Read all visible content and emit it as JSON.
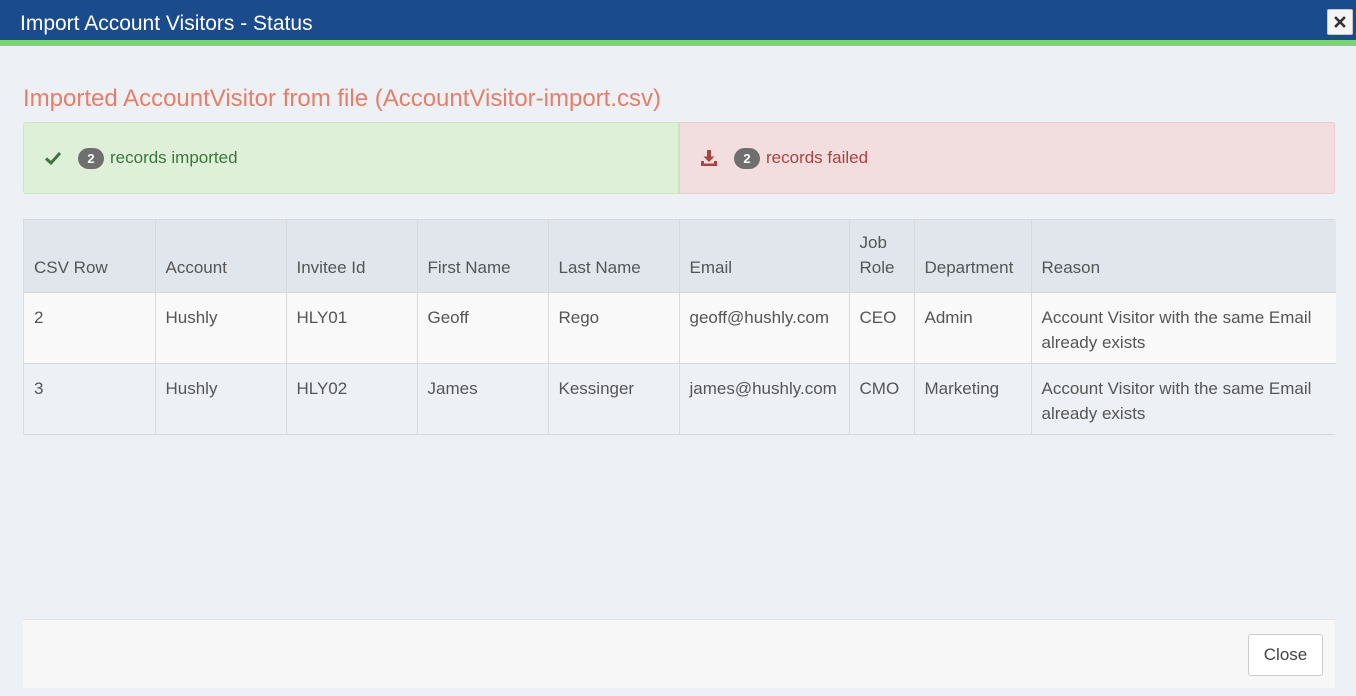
{
  "window": {
    "title": "Import Account Visitors - Status"
  },
  "heading": "Imported AccountVisitor from file (AccountVisitor-import.csv)",
  "alerts": {
    "success": {
      "count": "2",
      "label": "records imported",
      "icon": "check-icon",
      "color": "#3c763d"
    },
    "failed": {
      "count": "2",
      "label": "records failed",
      "icon": "download-icon",
      "color": "#a94442"
    }
  },
  "table": {
    "columns": [
      "CSV Row",
      "Account",
      "Invitee Id",
      "First Name",
      "Last Name",
      "Email",
      "Job Role",
      "Department",
      "Reason"
    ],
    "rows": [
      [
        "2",
        "Hushly",
        "HLY01",
        "Geoff",
        "Rego",
        "geoff@hushly.com",
        "CEO",
        "Admin",
        "Account Visitor with the same Email already exists"
      ],
      [
        "3",
        "Hushly",
        "HLY02",
        "James",
        "Kessinger",
        "james@hushly.com",
        "CMO",
        "Marketing",
        "Account Visitor with the same Email already exists"
      ]
    ]
  },
  "footer": {
    "close_label": "Close"
  },
  "colors": {
    "titlebar": "#1a4b8c",
    "accent_stripe": "#7fd17c",
    "heading": "#e4806a"
  }
}
